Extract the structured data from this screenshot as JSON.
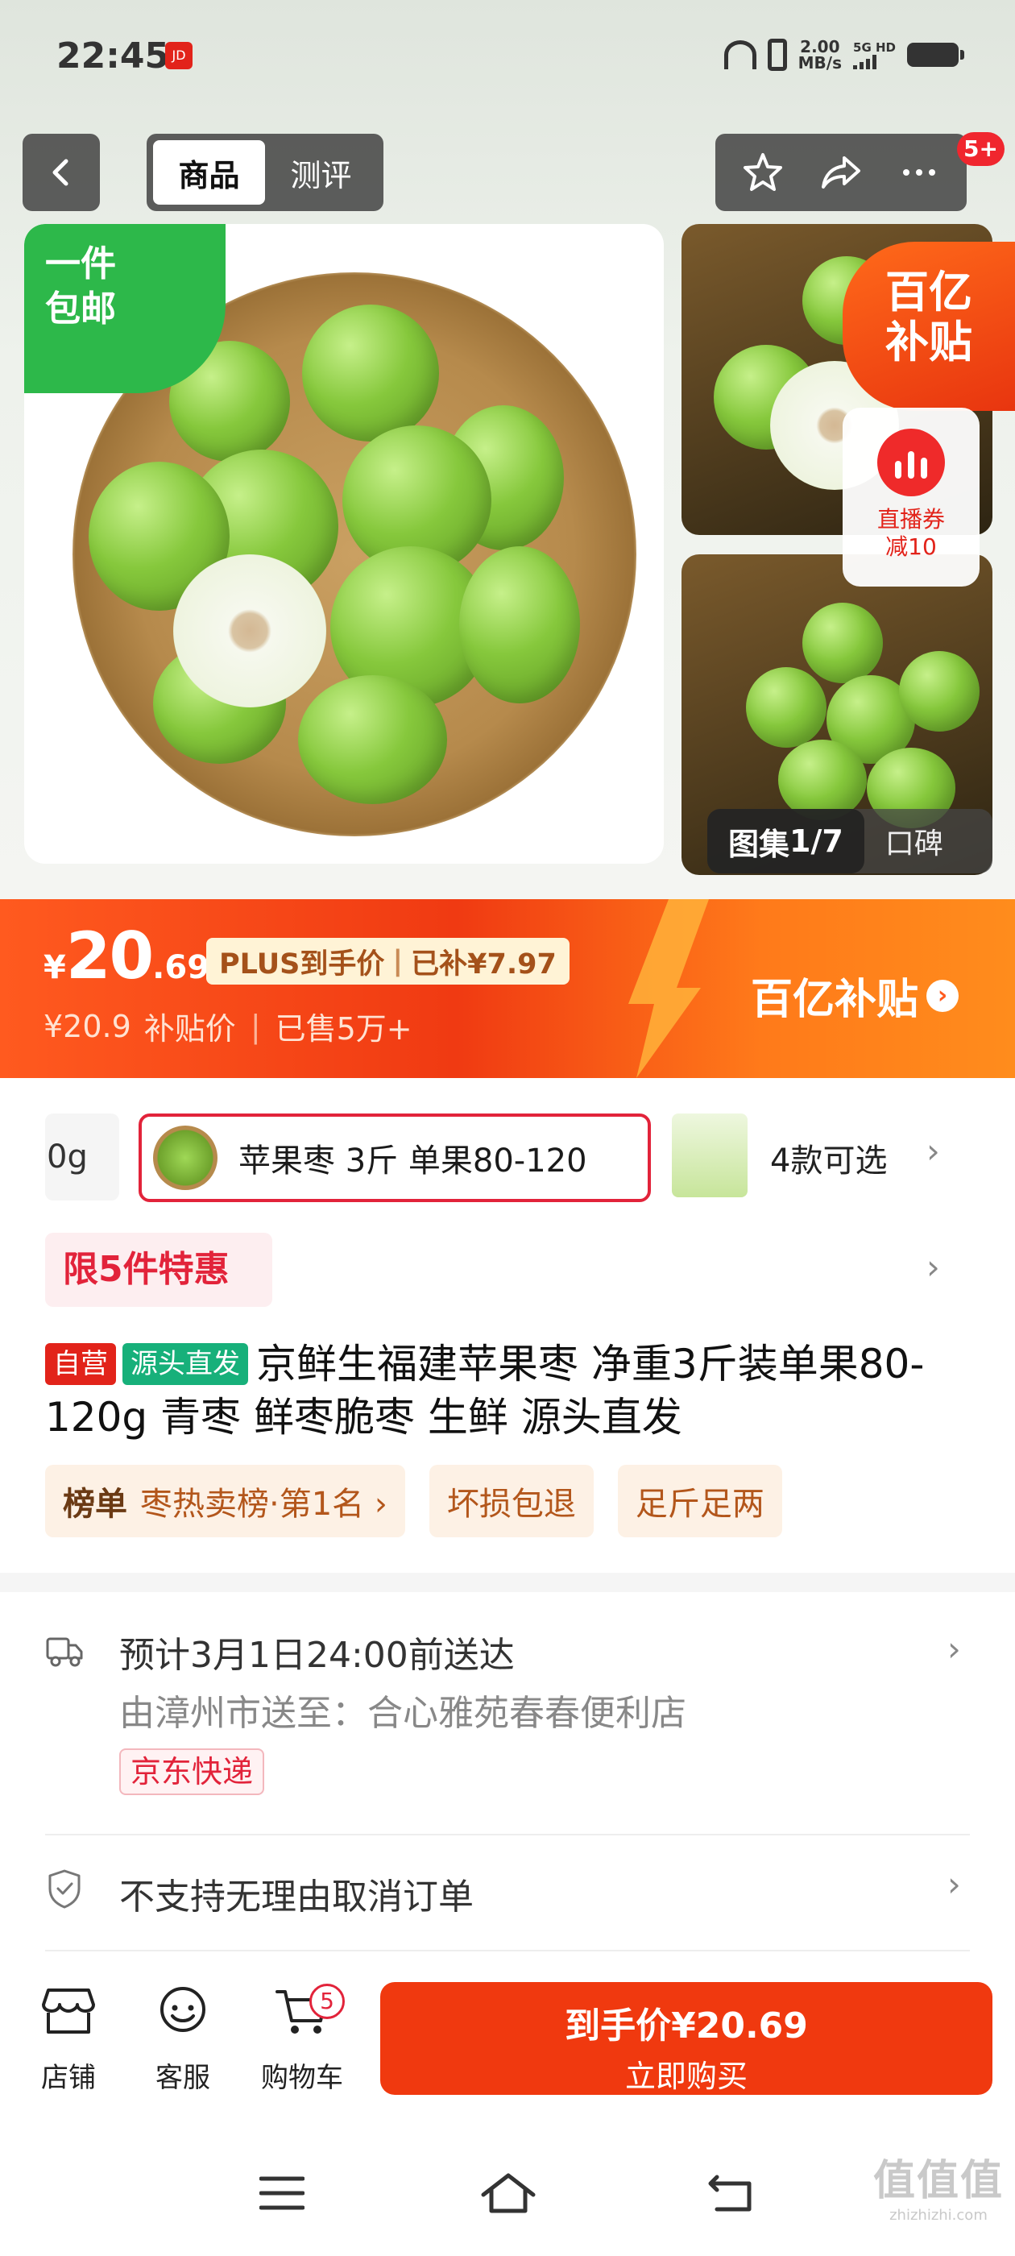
{
  "status_bar": {
    "time": "22:45",
    "net_speed_value": "2.00",
    "net_speed_unit": "MB/s",
    "network": "5G HD"
  },
  "nav": {
    "tabs": [
      {
        "label": "商品",
        "active": true
      },
      {
        "label": "测评",
        "active": false
      }
    ],
    "more_badge": "5+"
  },
  "gallery": {
    "free_shipping_badge_line1": "一件",
    "free_shipping_badge_line2": "包邮",
    "subsidy_badge_line1": "百亿",
    "subsidy_badge_line2": "补贴",
    "live_coupon_line1": "直播券",
    "live_coupon_line2": "减10",
    "album_label": "图集",
    "album_index": "1/7",
    "reviews_label": "口碑"
  },
  "price": {
    "currency": "¥",
    "integer": "20",
    "decimal": ".69",
    "plus_label": "PLUS到手价",
    "subsidized": "已补¥7.97",
    "original": "¥20.9",
    "original_label": "补贴价",
    "sold": "已售5万+",
    "subsidy_brand": "百亿补贴"
  },
  "variants": {
    "prev_fragment": "0g",
    "selected_label": "苹果枣 3斤 单果80-120",
    "more_label": "4款可选"
  },
  "promo": {
    "label": "限5件特惠"
  },
  "product": {
    "tag_self": "自营",
    "tag_source": "源头直发",
    "title": "京鲜生福建苹果枣 净重3斤装单果80-120g 青枣 鲜枣脆枣 生鲜 源头直发"
  },
  "chips": [
    {
      "prefix": "榜单",
      "label": "枣热卖榜·第1名 ›"
    },
    {
      "prefix": "",
      "label": "坏损包退"
    },
    {
      "prefix": "",
      "label": "足斤足两"
    }
  ],
  "delivery": {
    "estimate": "预计3月1日24:00前送达",
    "route": "由漳州市送至：合心雅苑春春便利店",
    "carrier": "京东快递"
  },
  "policy": {
    "no_cancel": "不支持无理由取消订单"
  },
  "bottom_bar": {
    "store": "店铺",
    "service": "客服",
    "cart": "购物车",
    "cart_count": "5",
    "buy_line1": "到手价¥20.69",
    "buy_line2": "立即购买"
  },
  "watermark": {
    "main": "值值值",
    "sub": "zhizhizhi.com"
  },
  "colors": {
    "accent_red": "#e2231a",
    "price_orange": "#f0390f",
    "free_ship_green": "#2db84a",
    "source_tag_green": "#17b07a"
  }
}
